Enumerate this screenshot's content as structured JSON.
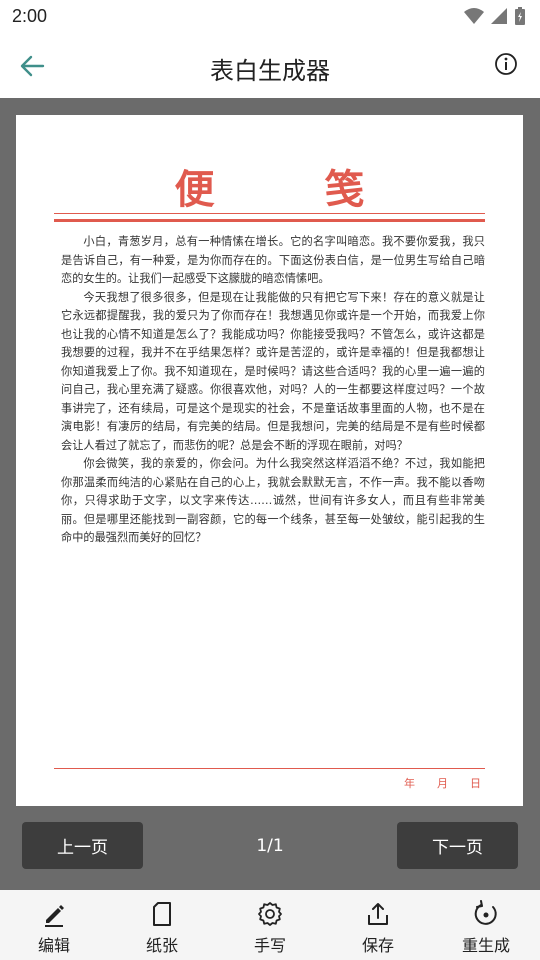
{
  "status_bar": {
    "time": "2:00"
  },
  "app_bar": {
    "title": "表白生成器"
  },
  "paper": {
    "title_left": "便",
    "title_right": "笺",
    "paragraphs": [
      "小白，青葱岁月，总有一种情愫在增长。它的名字叫暗恋。我不要你爱我，我只是告诉自己，有一种爱，是为你而存在的。下面这份表白信，是一位男生写给自己暗恋的女生的。让我们一起感受下这朦胧的暗恋情愫吧。",
      "今天我想了很多很多，但是现在让我能做的只有把它写下来！存在的意义就是让它永远都提醒我，我的爱只为了你而存在！我想遇见你或许是一个开始，而我爱上你也让我的心情不知道是怎么了？我能成功吗？你能接受我吗？不管怎么，或许这都是我想要的过程，我并不在乎结果怎样？或许是苦涩的，或许是幸福的！但是我都想让你知道我爱上了你。我不知道现在，是时候吗？请这些合适吗？我的心里一遍一遍的问自己，我心里充满了疑惑。你很喜欢他，对吗？人的一生都要这样度过吗？一个故事讲完了，还有续局，可是这个是现实的社会，不是童话故事里面的人物，也不是在演电影！有凄厉的结局，有完美的结局。但是我想问，完美的结局是不是有些时候都会让人看过了就忘了，而悲伤的呢？总是会不断的浮现在眼前，对吗？",
      "你会微笑，我的亲爱的，你会问。为什么我突然这样滔滔不绝？不过，我如能把你那温柔而纯洁的心紧贴在自己的心上，我就会默默无言，不作一声。我不能以香吻你，只得求助于文字，以文字来传达……诚然，世间有许多女人，而且有些非常美丽。但是哪里还能找到一副容颜，它的每一个线条，甚至每一处皱纹，能引起我的生命中的最强烈而美好的回忆？"
    ],
    "date_year": "年",
    "date_month": "月",
    "date_day": "日"
  },
  "pager": {
    "prev_label": "上一页",
    "next_label": "下一页",
    "indicator": "1/1"
  },
  "toolbar": {
    "items": [
      {
        "label": "编辑",
        "icon": "pen-icon"
      },
      {
        "label": "纸张",
        "icon": "paper-icon"
      },
      {
        "label": "手写",
        "icon": "gear-icon"
      },
      {
        "label": "保存",
        "icon": "share-icon"
      },
      {
        "label": "重生成",
        "icon": "regenerate-icon"
      }
    ]
  },
  "colors": {
    "accent_red": "#e05a4e",
    "back_arrow": "#3f8f8a",
    "workspace_gray": "#6b6b6b",
    "button_dark": "#3d3d3d"
  }
}
